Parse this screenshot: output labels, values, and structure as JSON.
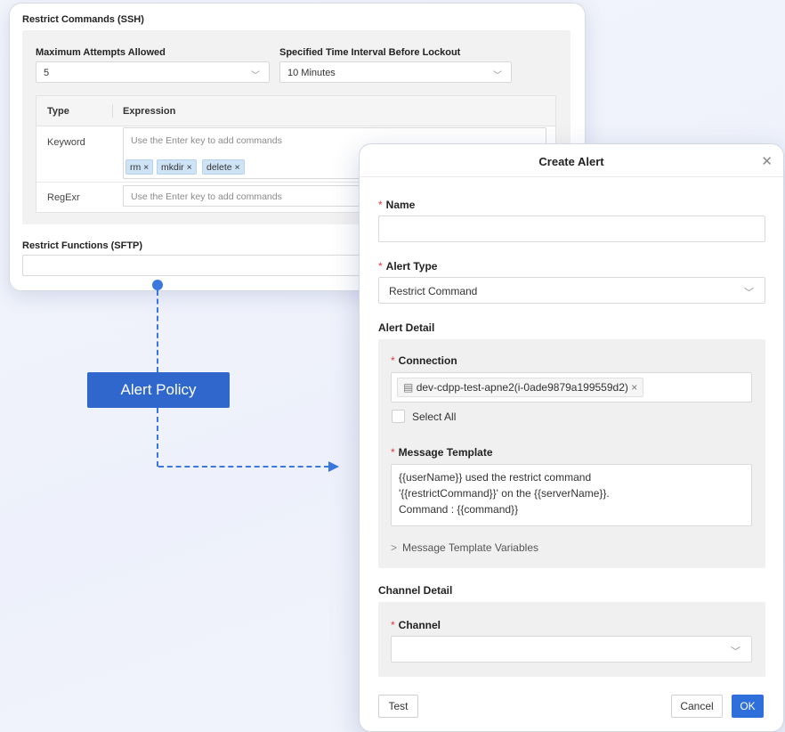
{
  "restrict_panel": {
    "ssh_title": "Restrict Commands (SSH)",
    "max_attempts_label": "Maximum Attempts Allowed",
    "max_attempts_value": "5",
    "interval_label": "Specified Time Interval Before Lockout",
    "interval_value": "10 Minutes",
    "table": {
      "col_type": "Type",
      "col_expression": "Expression",
      "rows": [
        {
          "type": "Keyword",
          "placeholder": "Use the Enter key to add commands",
          "tags": [
            "rm",
            "mkdir",
            "delete"
          ]
        },
        {
          "type": "RegExr",
          "placeholder": "Use the Enter key to add commands",
          "tags": []
        }
      ]
    },
    "sftp_title": "Restrict Functions (SFTP)"
  },
  "connector": {
    "label": "Alert Policy",
    "color": "#2f67cc"
  },
  "modal": {
    "title": "Create Alert",
    "close_icon": "close-icon",
    "name_label": "Name",
    "name_value": "",
    "alert_type_label": "Alert Type",
    "alert_type_value": "Restrict Command",
    "alert_detail_title": "Alert Detail",
    "connection_label": "Connection",
    "connection_tag": "dev-cdpp-test-apne2(i-0ade9879a199559d2)",
    "select_all_label": "Select All",
    "message_template_label": "Message Template",
    "message_template_lines": [
      "{{userName}} used the restrict command",
      "'{{restrictCommand}}' on the {{serverName}}.",
      "Command : {{command}}"
    ],
    "template_vars_label": "Message Template Variables",
    "channel_detail_title": "Channel Detail",
    "channel_label": "Channel",
    "channel_value": "",
    "test_button": "Test",
    "cancel_button": "Cancel",
    "ok_button": "OK",
    "accent_color": "#2f6fdc",
    "required_color": "#e0393e"
  }
}
